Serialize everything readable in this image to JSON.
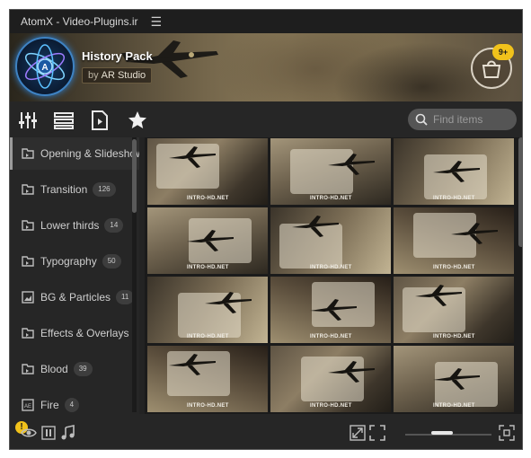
{
  "window": {
    "title": "AtomX - Video-Plugins.ir",
    "menu_icon": "hamburger-icon"
  },
  "header": {
    "pack_title": "History Pack",
    "author_prefix": "by",
    "author": "AR Studio",
    "cart_badge": "9+"
  },
  "toolbar": {
    "icons": [
      "sliders-icon",
      "list-view-icon",
      "media-file-icon",
      "star-icon"
    ],
    "search_placeholder": "Find items"
  },
  "sidebar": {
    "items": [
      {
        "label": "Opening & Slideshow",
        "count": "",
        "active": true
      },
      {
        "label": "Transition",
        "count": "126"
      },
      {
        "label": "Lower thirds",
        "count": "14"
      },
      {
        "label": "Typography",
        "count": "50"
      },
      {
        "label": "BG & Particles",
        "count": "11"
      },
      {
        "label": "Effects & Overlays",
        "count": ""
      },
      {
        "label": "Blood",
        "count": "39"
      },
      {
        "label": "Fire",
        "count": "4"
      }
    ]
  },
  "grid": {
    "watermark": "INTRO-HD.NET",
    "rows": 4,
    "cols": 3
  },
  "bottombar": {
    "warning_glyph": "!",
    "left_icons": [
      "eye-icon",
      "pause-icon",
      "music-icon"
    ],
    "right_icons": [
      "expand-icon",
      "fullscreen-icon",
      "resize-icon"
    ],
    "zoom_fraction": 0.4
  },
  "colors": {
    "accent": "#f1c21b",
    "panel": "#262626",
    "logo_ring": "#3e83c4"
  }
}
